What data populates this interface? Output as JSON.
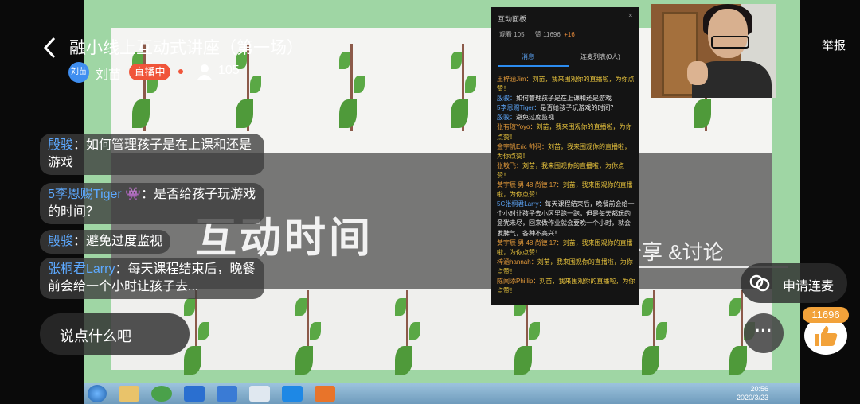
{
  "header": {
    "back_label": "‹",
    "title": "融小线上互动式讲座（第一场）",
    "host_avatar_text": "刘苗",
    "host_name": "刘苗",
    "live_badge": "直播中",
    "viewer_count": "105",
    "report_label": "举报"
  },
  "slide": {
    "title": "互动时间",
    "subtitle": "分享 &讨论"
  },
  "panel": {
    "title": "互动面板",
    "close": "×",
    "stats": {
      "views": "观看 105",
      "likes": "赞 11696",
      "likes_plus": "+16"
    },
    "tabs": [
      "消息",
      "连麦列表(0人)"
    ],
    "messages": [
      {
        "name": "王梓涵Jim：",
        "text": "刘苗，我来围观你的直播啦，为你点赞！",
        "kind": "join"
      },
      {
        "name": "殷骏：",
        "text": "如何管理孩子是在上课和还是游戏",
        "kind": "chat"
      },
      {
        "name": "5李恩赐Tiger：",
        "text": "是否给孩子玩游戏的时间？",
        "kind": "chat"
      },
      {
        "name": "殷骏：",
        "text": "避免过度监视",
        "kind": "chat"
      },
      {
        "name": "张有瑄Yoyo：",
        "text": "刘苗，我来围观你的直播啦，为你点赞！",
        "kind": "join"
      },
      {
        "name": "金宇帆Eric 帅码：",
        "text": "刘苗，我来围观你的直播啦，为你点赞！",
        "kind": "join"
      },
      {
        "name": "张敬飞：",
        "text": "刘苗，我来围观你的直播啦，为你点赞！",
        "kind": "join"
      },
      {
        "name": "黄宇辰 男 48 尚德 17：",
        "text": "刘苗，我来围观你的直播啦，为你点赞！",
        "kind": "join"
      },
      {
        "name": "5C张桐君Larry：",
        "text": "每天课程结束后，晚餐前会给一个小时让孩子去小区里跑一跑，但是每天都玩的意犹未尽，回来做作业就会要晚一个小时，就会发脾气，各种不高兴！",
        "kind": "chat"
      },
      {
        "name": "黄宇辰 男 48 尚德 17：",
        "text": "刘苗，我来围观你的直播啦，为你点赞！",
        "kind": "join"
      },
      {
        "name": "梓涵hannah：",
        "text": "刘苗，我来围观你的直播啦，为你点赞！",
        "kind": "join"
      },
      {
        "name": "陈闻添Phillip：",
        "text": "刘苗，我来围观你的直播啦，为你点赞！",
        "kind": "join"
      }
    ]
  },
  "chat": [
    {
      "name": "殷骏",
      "sep": "：",
      "text": "如何管理孩子是在上课和还是游戏"
    },
    {
      "name": "5李恩赐Tiger",
      "sep": " 👾：",
      "text": "是否给孩子玩游戏的时间？"
    },
    {
      "name": "殷骏",
      "sep": "：",
      "text": "避免过度监视"
    },
    {
      "name": "张桐君Larry",
      "sep": "：",
      "text": "每天课程结束后，晚餐前会给一个小时让孩子去..."
    }
  ],
  "input_placeholder": "说点什么吧",
  "mic_label": "申请连麦",
  "more_label": "···",
  "like_count": "11696",
  "taskbar": {
    "time": "20:56",
    "date": "2020/3/23"
  },
  "colors": {
    "live": "#f0553a",
    "name": "#5da9ff",
    "like": "#f2a23a",
    "slide_bg": "#9fd6a4"
  }
}
